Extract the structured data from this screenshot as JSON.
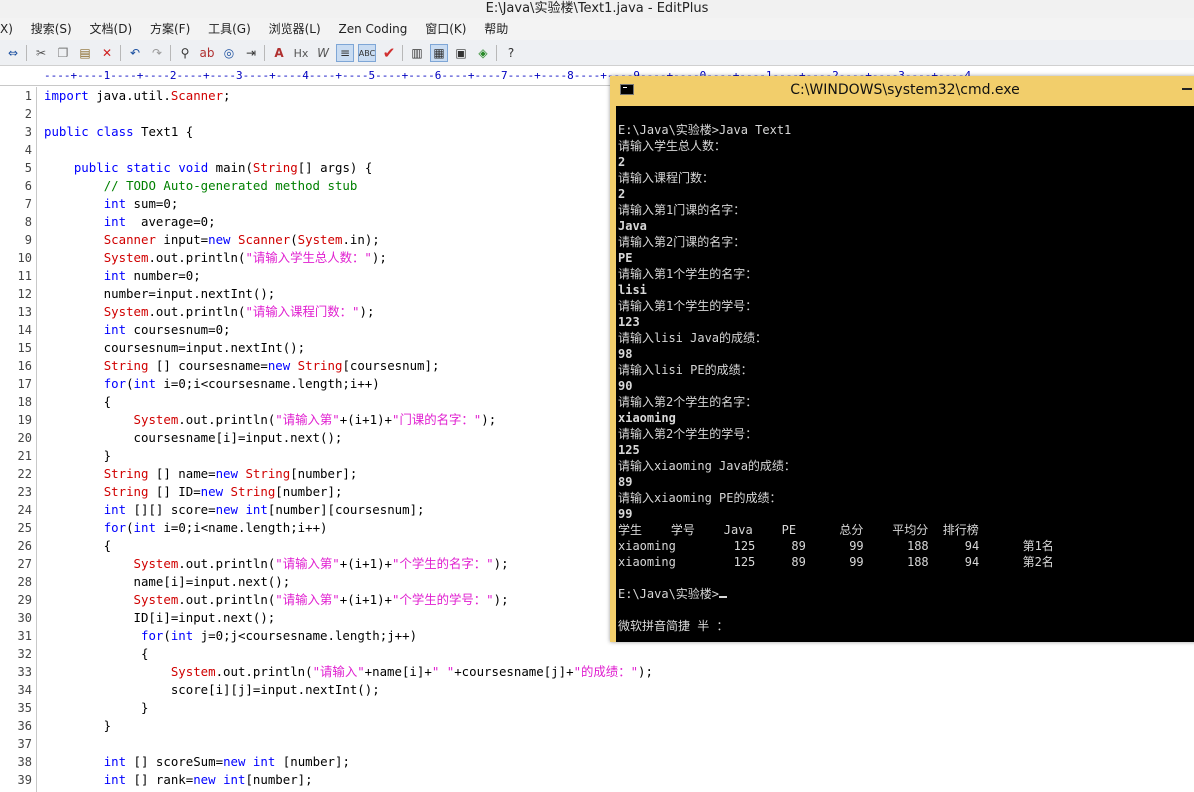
{
  "window": {
    "title": "E:\\Java\\实验楼\\Text1.java - EditPlus"
  },
  "menu": [
    "X)",
    "搜索(S)",
    "文档(D)",
    "方案(F)",
    "工具(G)",
    "浏览器(L)",
    "Zen Coding",
    "窗口(K)",
    "帮助"
  ],
  "ruler": "----+----1----+----2----+----3----+----4----+----5----+----6----+----7----+----8----+----9----+----0----+----1----+----2----+----3----+----4",
  "code_lines": [
    "import java.util.Scanner;",
    "",
    "public class Text1 {",
    "",
    "    public static void main(String[] args) {",
    "        // TODO Auto-generated method stub",
    "        int sum=0;",
    "        int  average=0;",
    "        Scanner input=new Scanner(System.in);",
    "        System.out.println(\"请输入学生总人数：\");",
    "        int number=0;",
    "        number=input.nextInt();",
    "        System.out.println(\"请输入课程门数：\");",
    "        int coursesnum=0;",
    "        coursesnum=input.nextInt();",
    "        String [] coursesname=new String[coursesnum];",
    "        for(int i=0;i<coursesname.length;i++)",
    "        {",
    "            System.out.println(\"请输入第\"+(i+1)+\"门课的名字：\");",
    "            coursesname[i]=input.next();",
    "        }",
    "        String [] name=new String[number];",
    "        String [] ID=new String[number];",
    "        int [][] score=new int[number][coursesnum];",
    "        for(int i=0;i<name.length;i++)",
    "        {",
    "            System.out.println(\"请输入第\"+(i+1)+\"个学生的名字：\");",
    "            name[i]=input.next();",
    "            System.out.println(\"请输入第\"+(i+1)+\"个学生的学号：\");",
    "            ID[i]=input.next();",
    "             for(int j=0;j<coursesname.length;j++)",
    "             {",
    "                 System.out.println(\"请输入\"+name[i]+\" \"+coursesname[j]+\"的成绩：\");",
    "                 score[i][j]=input.nextInt();",
    "             }",
    "        }",
    "",
    "        int [] scoreSum=new int [number];",
    "        int [] rank=new int[number];"
  ],
  "cmd": {
    "title": "C:\\WINDOWS\\system32\\cmd.exe",
    "lines": [
      "",
      "E:\\Java\\实验楼>Java Text1",
      "请输入学生总人数：",
      "2",
      "请输入课程门数：",
      "2",
      "请输入第1门课的名字：",
      "Java",
      "请输入第2门课的名字：",
      "PE",
      "请输入第1个学生的名字：",
      "lisi",
      "请输入第1个学生的学号：",
      "123",
      "请输入lisi Java的成绩：",
      "98",
      "请输入lisi PE的成绩：",
      "90",
      "请输入第2个学生的名字：",
      "xiaoming",
      "请输入第2个学生的学号：",
      "125",
      "请输入xiaoming Java的成绩：",
      "89",
      "请输入xiaoming PE的成绩：",
      "99",
      "学生    学号    Java    PE      总分    平均分  排行榜",
      "xiaoming        125     89      99      188     94      第1名",
      "xiaoming        125     89      99      188     94      第2名",
      "",
      "E:\\Java\\实验楼>",
      "",
      "微软拼音简捷 半 ："
    ]
  }
}
